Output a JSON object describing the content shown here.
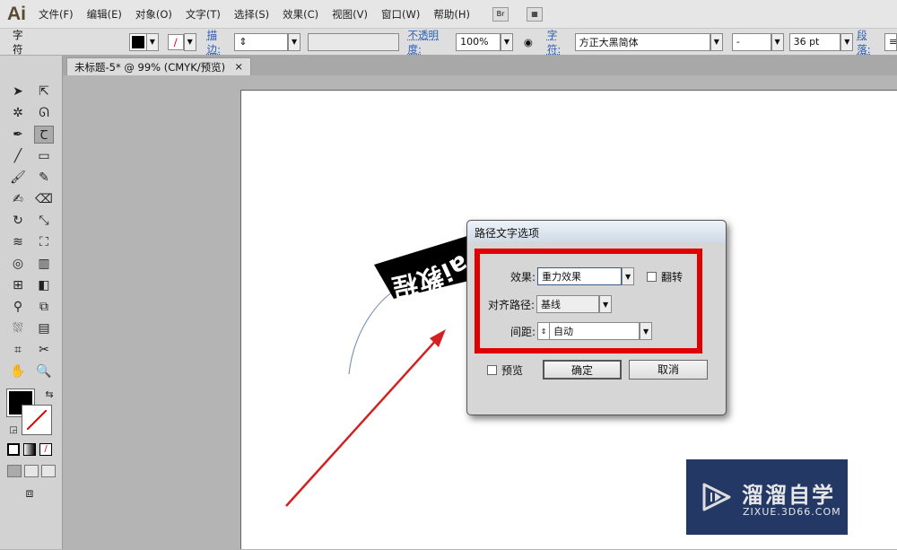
{
  "app": {
    "logo": "Ai",
    "menus": [
      "文件(F)",
      "编辑(E)",
      "对象(O)",
      "文字(T)",
      "选择(S)",
      "效果(C)",
      "视图(V)",
      "窗口(W)",
      "帮助(H)"
    ],
    "bridge_label": "Br"
  },
  "control_bar": {
    "panel_label": "字符",
    "stroke_label": "描边:",
    "opacity_label": "不透明度:",
    "opacity_value": "100%",
    "character_label": "字符:",
    "font_family": "方正大黑简体",
    "font_style": "-",
    "font_size": "36 pt",
    "paragraph_label": "段落:"
  },
  "document_tab": {
    "title": "未标题-5* @ 99% (CMYK/预览)",
    "close": "×"
  },
  "canvas": {
    "path_text": "ai教程"
  },
  "dialog": {
    "title": "路径文字选项",
    "effect_label": "效果:",
    "effect_value": "重力效果",
    "flip_label": "翻转",
    "flip_checked": false,
    "align_label": "对齐路径:",
    "align_value": "基线",
    "spacing_label": "间距:",
    "spacing_value": "自动",
    "preview_label": "预览",
    "preview_checked": false,
    "ok": "确定",
    "cancel": "取消"
  },
  "watermark": {
    "name": "溜溜自学",
    "url": "ZIXUE.3D66.COM"
  },
  "colors": {
    "highlight": "#e00000",
    "arrow": "#d42020",
    "watermark_bg": "#243866"
  }
}
